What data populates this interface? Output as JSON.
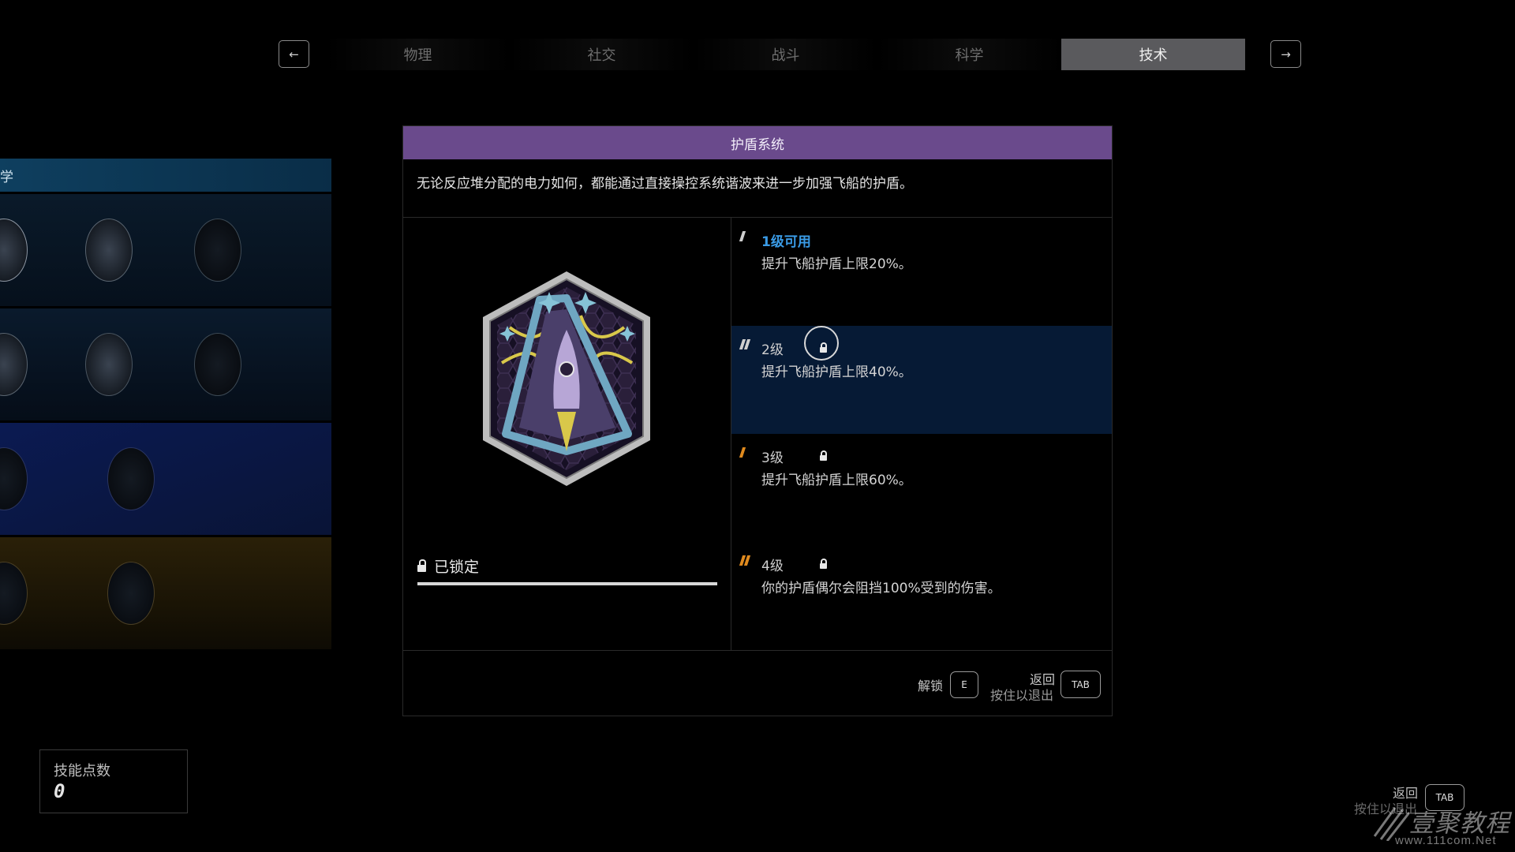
{
  "tabs": {
    "prev_arrow": "←",
    "next_arrow": "→",
    "items": [
      {
        "label": "物理",
        "active": false
      },
      {
        "label": "社交",
        "active": false
      },
      {
        "label": "战斗",
        "active": false
      },
      {
        "label": "科学",
        "active": false
      },
      {
        "label": "技术",
        "active": true
      }
    ]
  },
  "tree": {
    "header_label": "学"
  },
  "skill": {
    "title": "护盾系统",
    "description": "无论反应堆分配的电力如何，都能通过直接操控系统谐波来进一步加强飞船的护盾。",
    "status_label": "已锁定",
    "progress": 1.0,
    "badge_icon": "shield-rocket-patch-icon",
    "ranks": [
      {
        "label": "1级可用",
        "desc": "提升飞船护盾上限20%。",
        "pips": 1,
        "pip_color": "#cfcfcf",
        "locked": false,
        "available": true,
        "selected": false
      },
      {
        "label": "2级",
        "desc": "提升飞船护盾上限40%。",
        "pips": 2,
        "pip_color": "#cfcfcf",
        "locked": true,
        "available": false,
        "selected": true
      },
      {
        "label": "3级",
        "desc": "提升飞船护盾上限60%。",
        "pips": 1,
        "pip_color": "#e08a1e",
        "locked": true,
        "available": false,
        "selected": false
      },
      {
        "label": "4级",
        "desc": "你的护盾偶尔会阻挡100%受到的伤害。",
        "pips": 2,
        "pip_color": "#e08a1e",
        "locked": true,
        "available": false,
        "selected": false
      }
    ]
  },
  "footer": {
    "unlock_label": "解锁",
    "unlock_key": "E",
    "back_label": "返回",
    "hold_label": "按住以退出",
    "back_key": "TAB"
  },
  "points": {
    "label": "技能点数",
    "value": "0"
  },
  "bottom_hint": {
    "back_label": "返回",
    "hold_label": "按住以退出",
    "key": "TAB"
  },
  "watermark": {
    "text": "壹聚教程",
    "url": "www.111com.Net"
  },
  "colors": {
    "title_bar": "#6a4a8c",
    "rank_available": "#3a9be6",
    "rank_selected_bg": "#061a35",
    "tier_orange": "#e08a1e"
  }
}
